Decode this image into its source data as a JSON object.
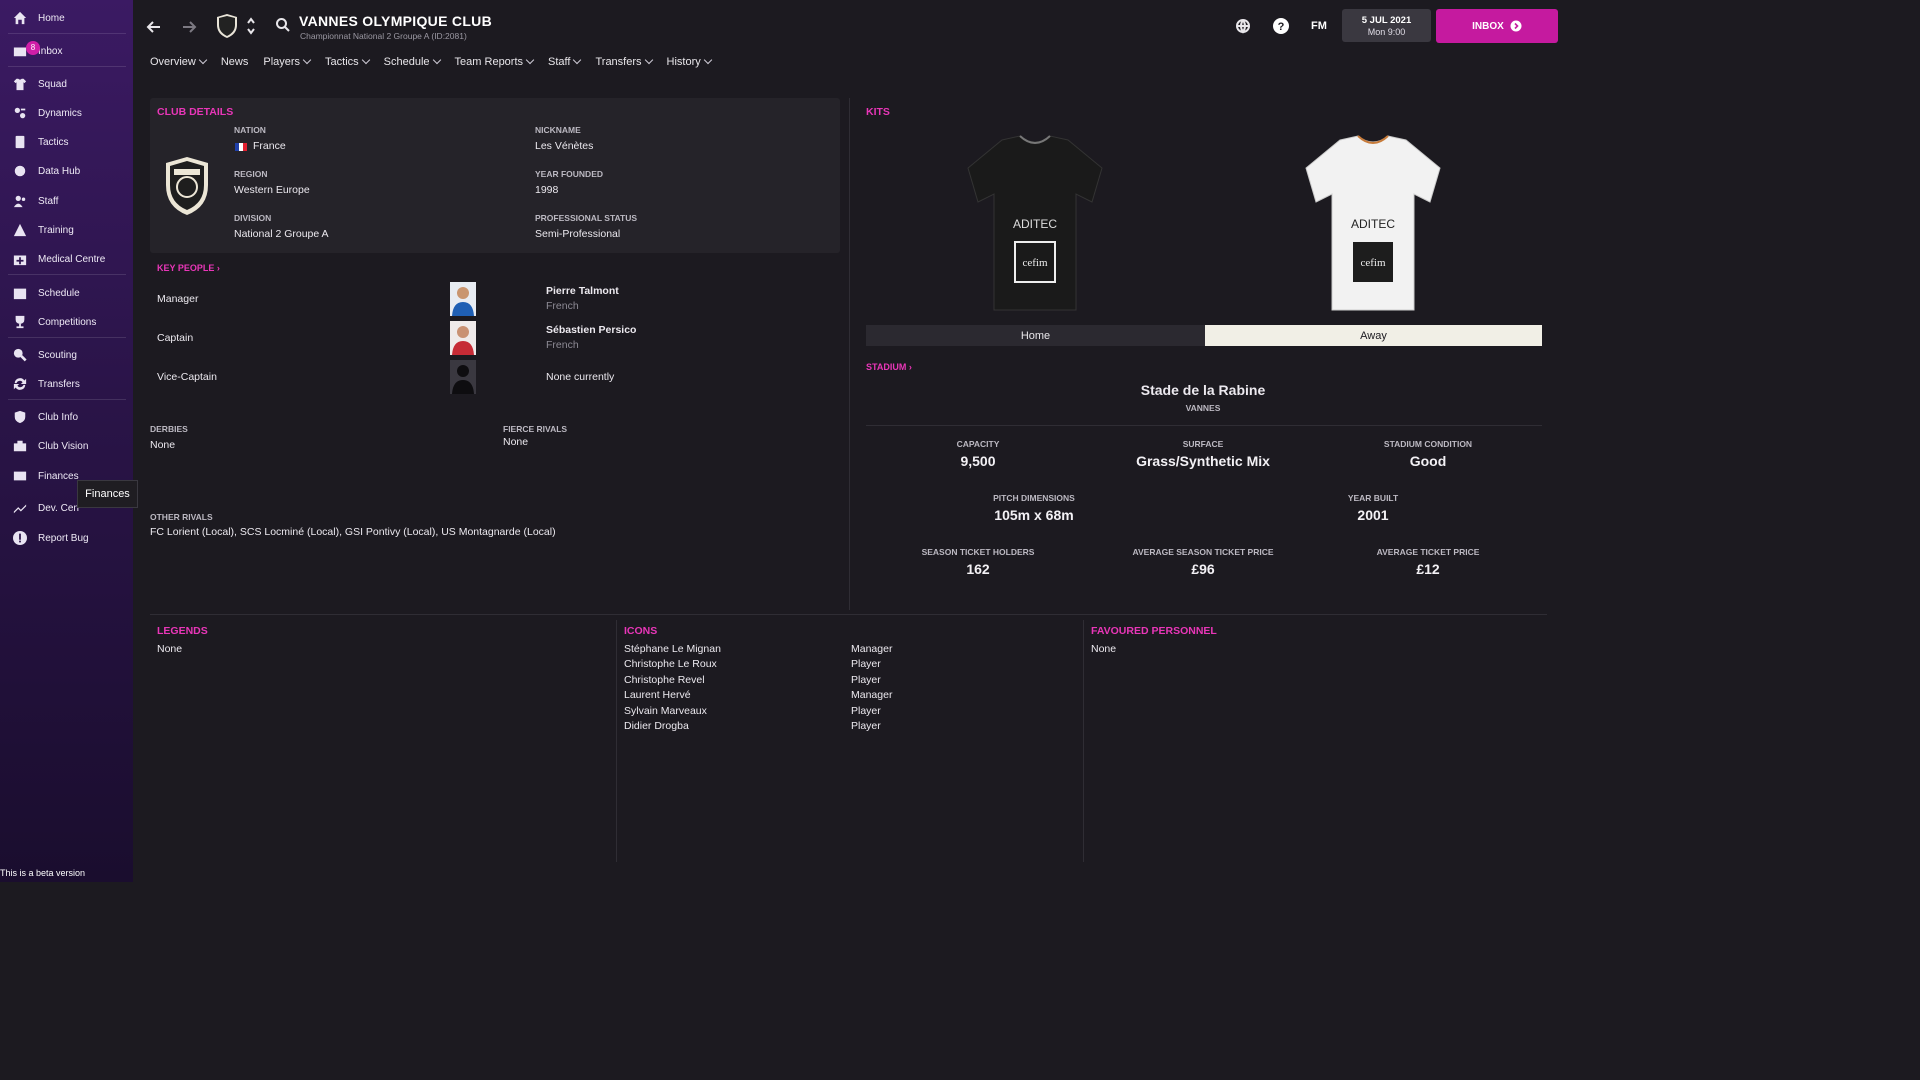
{
  "sidebar": {
    "items": [
      {
        "label": "Home",
        "icon": "home-icon"
      },
      {
        "label": "Inbox",
        "icon": "inbox-icon",
        "badge": "8"
      },
      {
        "label": "Squad",
        "icon": "shirt-icon"
      },
      {
        "label": "Dynamics",
        "icon": "dynamics-icon"
      },
      {
        "label": "Tactics",
        "icon": "tactics-icon"
      },
      {
        "label": "Data Hub",
        "icon": "data-hub-icon"
      },
      {
        "label": "Staff",
        "icon": "staff-icon"
      },
      {
        "label": "Training",
        "icon": "training-icon"
      },
      {
        "label": "Medical Centre",
        "icon": "medical-icon"
      },
      {
        "label": "Schedule",
        "icon": "calendar-icon"
      },
      {
        "label": "Competitions",
        "icon": "trophy-icon"
      },
      {
        "label": "Scouting",
        "icon": "scouting-icon"
      },
      {
        "label": "Transfers",
        "icon": "transfers-icon"
      },
      {
        "label": "Club Info",
        "icon": "shield-icon"
      },
      {
        "label": "Club Vision",
        "icon": "vision-icon"
      },
      {
        "label": "Finances",
        "icon": "finances-icon"
      },
      {
        "label": "Dev. Cen",
        "icon": "dev-centre-icon"
      },
      {
        "label": "Report Bug",
        "icon": "report-bug-icon"
      }
    ],
    "tooltip": "Finances",
    "beta_text": "This is a beta version"
  },
  "header": {
    "club_name": "VANNES OLYMPIQUE CLUB",
    "club_subtitle": "Championnat National 2 Groupe A (ID:2081)",
    "fm_label": "FM",
    "date": "5 JUL 2021",
    "time": "Mon 9:00",
    "inbox_label": "INBOX"
  },
  "nav": [
    {
      "label": "Overview",
      "dropdown": true
    },
    {
      "label": "News",
      "dropdown": false
    },
    {
      "label": "Players",
      "dropdown": true
    },
    {
      "label": "Tactics",
      "dropdown": true
    },
    {
      "label": "Schedule",
      "dropdown": true
    },
    {
      "label": "Team Reports",
      "dropdown": true
    },
    {
      "label": "Staff",
      "dropdown": true
    },
    {
      "label": "Transfers",
      "dropdown": true
    },
    {
      "label": "History",
      "dropdown": true
    }
  ],
  "club_details": {
    "title": "CLUB DETAILS",
    "nation_label": "NATION",
    "nation": "France",
    "region_label": "REGION",
    "region": "Western Europe",
    "division_label": "DIVISION",
    "division": "National 2 Groupe A",
    "nickname_label": "NICKNAME",
    "nickname": "Les Vénètes",
    "founded_label": "YEAR FOUNDED",
    "founded": "1998",
    "status_label": "PROFESSIONAL STATUS",
    "status": "Semi-Professional"
  },
  "key_people": {
    "title": "KEY PEOPLE",
    "rows": [
      {
        "role": "Manager",
        "name": "Pierre Talmont",
        "nationality": "French"
      },
      {
        "role": "Captain",
        "name": "Sébastien Persico",
        "nationality": "French"
      },
      {
        "role": "Vice-Captain",
        "name": "None currently",
        "nationality": ""
      }
    ]
  },
  "rivals": {
    "derbies_label": "DERBIES",
    "derbies": "None",
    "fierce_label": "FIERCE RIVALS",
    "fierce": "None",
    "other_label": "OTHER RIVALS",
    "other": "FC Lorient (Local), SCS Locminé (Local), GSI Pontivy (Local), US Montagnarde (Local)"
  },
  "kits": {
    "title": "KITS",
    "home_label": "Home",
    "away_label": "Away",
    "sponsor": "ADITEC",
    "box_sponsor": "cefim",
    "home_color": "#1a1a1a",
    "away_color": "#f2f2f2"
  },
  "stadium": {
    "title": "STADIUM",
    "name": "Stade de la Rabine",
    "city": "VANNES",
    "capacity_label": "CAPACITY",
    "capacity": "9,500",
    "surface_label": "SURFACE",
    "surface": "Grass/Synthetic Mix",
    "condition_label": "STADIUM CONDITION",
    "condition": "Good",
    "pitch_label": "PITCH DIMENSIONS",
    "pitch": "105m x 68m",
    "built_label": "YEAR BUILT",
    "built": "2001",
    "season_holders_label": "SEASON TICKET HOLDERS",
    "season_holders": "162",
    "avg_season_label": "AVERAGE SEASON TICKET PRICE",
    "avg_season": "£96",
    "avg_ticket_label": "AVERAGE TICKET PRICE",
    "avg_ticket": "£12"
  },
  "legends": {
    "title": "LEGENDS",
    "value": "None"
  },
  "icons": {
    "title": "ICONS",
    "rows": [
      {
        "name": "Stéphane Le Mignan",
        "role": "Manager"
      },
      {
        "name": "Christophe Le Roux",
        "role": "Player"
      },
      {
        "name": "Christophe Revel",
        "role": "Player"
      },
      {
        "name": "Laurent Hervé",
        "role": "Manager"
      },
      {
        "name": "Sylvain Marveaux",
        "role": "Player"
      },
      {
        "name": "Didier Drogba",
        "role": "Player"
      }
    ]
  },
  "favoured": {
    "title": "FAVOURED PERSONNEL",
    "value": "None"
  },
  "colors": {
    "accent": "#e936b8",
    "inbox": "#c51a9f"
  }
}
